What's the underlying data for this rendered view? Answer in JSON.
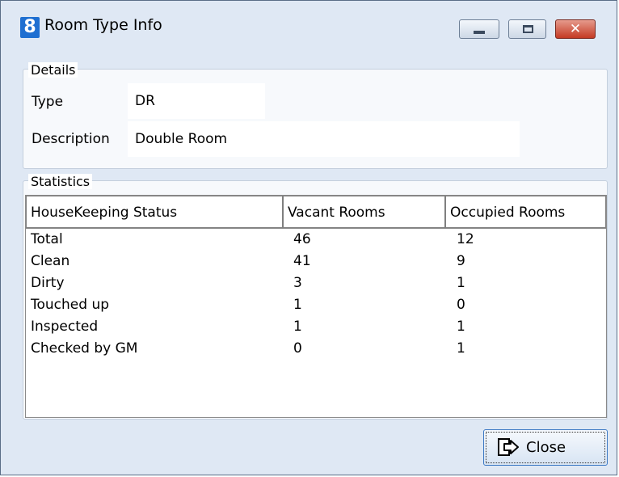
{
  "window": {
    "title": "Room Type Info",
    "app_icon_glyph": "8",
    "controls": {
      "minimize": "minimize-icon",
      "maximize": "maximize-icon",
      "close": "close-icon"
    }
  },
  "details": {
    "legend": "Details",
    "type_label": "Type",
    "type_value": "DR",
    "description_label": "Description",
    "description_value": "Double Room"
  },
  "statistics": {
    "legend": "Statistics",
    "columns": [
      "HouseKeeping Status",
      "Vacant Rooms",
      "Occupied Rooms"
    ],
    "rows": [
      [
        "Total",
        "46",
        "12"
      ],
      [
        "Clean",
        "41",
        "9"
      ],
      [
        "Dirty",
        "3",
        "1"
      ],
      [
        "Touched up",
        "1",
        "0"
      ],
      [
        "Inspected",
        "1",
        "1"
      ],
      [
        "Checked by GM",
        "0",
        "1"
      ]
    ]
  },
  "footer": {
    "close_button_label": "Close",
    "close_button_icon": "exit-arrow-icon"
  },
  "colors": {
    "window_background": "#dfe8f4",
    "close_control": "#c43b24",
    "app_icon": "#1f6fd1"
  }
}
